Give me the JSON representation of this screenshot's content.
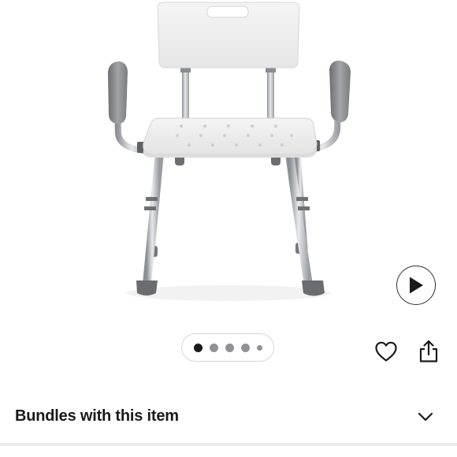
{
  "product": {
    "image_alt": "Shower chair with back and armrests",
    "video_icon": "play-icon"
  },
  "carousel": {
    "dots": [
      "active",
      "inactive",
      "inactive",
      "inactive",
      "small"
    ]
  },
  "actions": {
    "favorite_icon": "heart-icon",
    "share_icon": "share-icon"
  },
  "bundles": {
    "title": "Bundles with this item",
    "icon": "chevron-down-icon"
  },
  "colors": {
    "text": "#1a1a1a",
    "dot_inactive": "#909196",
    "border": "#d6d6d6"
  }
}
